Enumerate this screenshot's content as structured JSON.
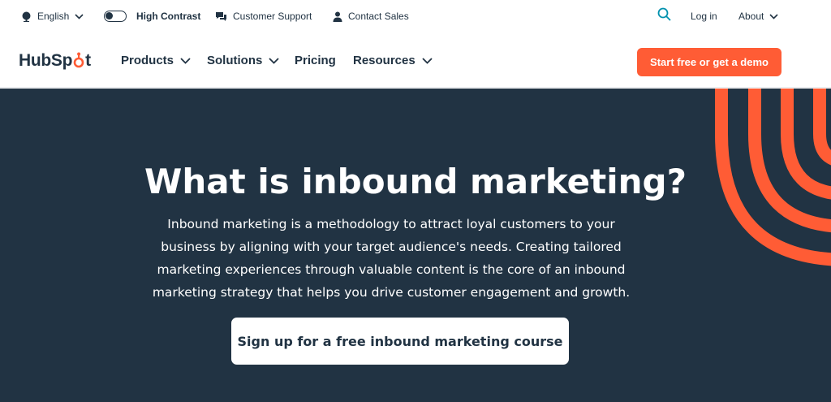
{
  "utility": {
    "language": "English",
    "high_contrast": "High Contrast",
    "customer_support": "Customer Support",
    "contact_sales": "Contact Sales",
    "login": "Log in",
    "about": "About"
  },
  "nav": {
    "logo": {
      "prefix": "HubSp",
      "o": "o",
      "suffix": "t"
    },
    "items": [
      {
        "label": "Products",
        "dropdown": true
      },
      {
        "label": "Solutions",
        "dropdown": true
      },
      {
        "label": "Pricing",
        "dropdown": false
      },
      {
        "label": "Resources",
        "dropdown": true
      }
    ],
    "cta": "Start free or get a demo"
  },
  "hero": {
    "title": "What is inbound marketing?",
    "description": "Inbound marketing is a methodology to attract loyal customers to your business by aligning with your target audience's needs. Creating tailored marketing experiences through valuable content is the core of an inbound marketing strategy that helps you drive customer engagement and growth.",
    "button": "Sign up for a free inbound marketing course"
  },
  "colors": {
    "brand_orange": "#ff5c35",
    "navy": "#213343",
    "link_blue": "#0091ae"
  },
  "icons": [
    "globe-icon",
    "chevron-down-icon",
    "toggle-icon",
    "chat-icon",
    "person-icon",
    "search-icon"
  ]
}
